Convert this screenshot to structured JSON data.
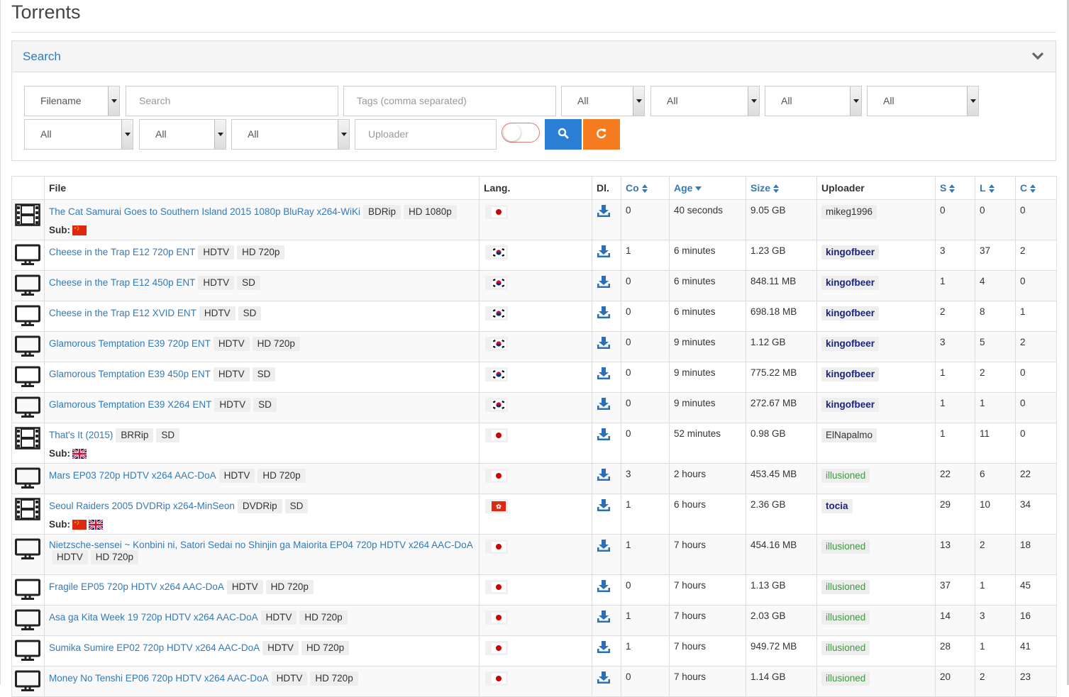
{
  "page": {
    "title": "Torrents"
  },
  "search_panel": {
    "title": "Search",
    "field_type": "Filename",
    "search_placeholder": "Search",
    "tags_placeholder": "Tags (comma separated)",
    "selects_row1": [
      "All",
      "All",
      "All",
      "All"
    ],
    "selects_row2": [
      "All",
      "All",
      "All"
    ],
    "uploader_placeholder": "Uploader"
  },
  "table": {
    "headers": {
      "file": "File",
      "lang": "Lang.",
      "dl": "Dl.",
      "co": "Co",
      "age": "Age",
      "size": "Size",
      "uploader": "Uploader",
      "s": "S",
      "l": "L",
      "c": "C"
    },
    "sub_label": "Sub:",
    "rows": [
      {
        "icon": "film",
        "name": "The Cat Samurai Goes to Southern Island 2015 1080p BluRay x264-WiKi",
        "tags": [
          "BDRip",
          "HD 1080p"
        ],
        "subs": [
          "cn"
        ],
        "lang": "jp",
        "co": "0",
        "age": "40 seconds",
        "size": "9.05 GB",
        "uploader": "mikeg1996",
        "utype": "plain",
        "s": "0",
        "l": "0",
        "c": "0"
      },
      {
        "icon": "tv",
        "name": "Cheese in the Trap E12 720p ENT",
        "tags": [
          "HDTV",
          "HD 720p"
        ],
        "subs": [],
        "lang": "kr",
        "co": "1",
        "age": "6 minutes",
        "size": "1.23 GB",
        "uploader": "kingofbeer",
        "utype": "gold",
        "s": "3",
        "l": "37",
        "c": "2"
      },
      {
        "icon": "tv",
        "name": "Cheese in the Trap E12 450p ENT",
        "tags": [
          "HDTV",
          "SD"
        ],
        "subs": [],
        "lang": "kr",
        "co": "0",
        "age": "6 minutes",
        "size": "848.11 MB",
        "uploader": "kingofbeer",
        "utype": "gold",
        "s": "1",
        "l": "4",
        "c": "0"
      },
      {
        "icon": "tv",
        "name": "Cheese in the Trap E12 XVID ENT",
        "tags": [
          "HDTV",
          "SD"
        ],
        "subs": [],
        "lang": "kr",
        "co": "0",
        "age": "6 minutes",
        "size": "698.18 MB",
        "uploader": "kingofbeer",
        "utype": "gold",
        "s": "2",
        "l": "8",
        "c": "1"
      },
      {
        "icon": "tv",
        "name": "Glamorous Temptation E39 720p ENT",
        "tags": [
          "HDTV",
          "HD 720p"
        ],
        "subs": [],
        "lang": "kr",
        "co": "0",
        "age": "9 minutes",
        "size": "1.12 GB",
        "uploader": "kingofbeer",
        "utype": "gold",
        "s": "3",
        "l": "5",
        "c": "2"
      },
      {
        "icon": "tv",
        "name": "Glamorous Temptation E39 450p ENT",
        "tags": [
          "HDTV",
          "SD"
        ],
        "subs": [],
        "lang": "kr",
        "co": "0",
        "age": "9 minutes",
        "size": "775.22 MB",
        "uploader": "kingofbeer",
        "utype": "gold",
        "s": "1",
        "l": "2",
        "c": "0"
      },
      {
        "icon": "tv",
        "name": "Glamorous Temptation E39 X264 ENT",
        "tags": [
          "HDTV",
          "SD"
        ],
        "subs": [],
        "lang": "kr",
        "co": "0",
        "age": "9 minutes",
        "size": "272.67 MB",
        "uploader": "kingofbeer",
        "utype": "gold",
        "s": "1",
        "l": "1",
        "c": "0"
      },
      {
        "icon": "film",
        "name": "That's It (2015)",
        "tags": [
          "BRRip",
          "SD"
        ],
        "subs": [
          "uk"
        ],
        "lang": "jp",
        "co": "0",
        "age": "52 minutes",
        "size": "0.98 GB",
        "uploader": "ElNapalmo",
        "utype": "plain",
        "s": "1",
        "l": "11",
        "c": "0"
      },
      {
        "icon": "tv",
        "name": "Mars EP03 720p HDTV x264 AAC-DoA",
        "tags": [
          "HDTV",
          "HD 720p"
        ],
        "subs": [],
        "lang": "jp",
        "co": "3",
        "age": "2 hours",
        "size": "453.45 MB",
        "uploader": "illusioned",
        "utype": "green",
        "s": "22",
        "l": "6",
        "c": "22"
      },
      {
        "icon": "film",
        "name": "Seoul Raiders 2005 DVDRip x264-MinSeon",
        "tags": [
          "DVDRip",
          "SD"
        ],
        "subs": [
          "cn",
          "uk"
        ],
        "lang": "hk",
        "co": "1",
        "age": "6 hours",
        "size": "2.36 GB",
        "uploader": "tocia",
        "utype": "blue",
        "s": "29",
        "l": "10",
        "c": "34"
      },
      {
        "icon": "tv",
        "name": "Nietzsche-sensei ~ Konbini ni, Satori Sedai no Shinjin ga Maiorita EP04 720p HDTV x264 AAC-DoA",
        "tags": [
          "HDTV",
          "HD 720p"
        ],
        "subs": [],
        "lang": "jp",
        "co": "1",
        "age": "7 hours",
        "size": "454.16 MB",
        "uploader": "illusioned",
        "utype": "green",
        "s": "13",
        "l": "2",
        "c": "18"
      },
      {
        "icon": "tv",
        "name": "Fragile EP05 720p HDTV x264 AAC-DoA",
        "tags": [
          "HDTV",
          "HD 720p"
        ],
        "subs": [],
        "lang": "jp",
        "co": "0",
        "age": "7 hours",
        "size": "1.13 GB",
        "uploader": "illusioned",
        "utype": "green",
        "s": "37",
        "l": "1",
        "c": "45"
      },
      {
        "icon": "tv",
        "name": "Asa ga Kita Week 19 720p HDTV x264 AAC-DoA",
        "tags": [
          "HDTV",
          "HD 720p"
        ],
        "subs": [],
        "lang": "jp",
        "co": "1",
        "age": "7 hours",
        "size": "2.03 GB",
        "uploader": "illusioned",
        "utype": "green",
        "s": "14",
        "l": "3",
        "c": "16"
      },
      {
        "icon": "tv",
        "name": "Sumika Sumire EP02 720p HDTV x264 AAC-DoA",
        "tags": [
          "HDTV",
          "HD 720p"
        ],
        "subs": [],
        "lang": "jp",
        "co": "1",
        "age": "7 hours",
        "size": "949.72 MB",
        "uploader": "illusioned",
        "utype": "green",
        "s": "28",
        "l": "1",
        "c": "41"
      },
      {
        "icon": "tv",
        "name": "Money No Tenshi EP06 720p HDTV x264 AAC-DoA",
        "tags": [
          "HDTV",
          "HD 720p"
        ],
        "subs": [],
        "lang": "jp",
        "co": "0",
        "age": "7 hours",
        "size": "1.14 GB",
        "uploader": "illusioned",
        "utype": "green",
        "s": "20",
        "l": "2",
        "c": "23"
      }
    ]
  },
  "colors": {
    "link": "#337ab7",
    "search_button": "#2a7fd4",
    "reset_button": "#f47b20",
    "toggle_border": "#e07b6e",
    "uploader_trusted": "#3c9a3c",
    "uploader_vip": "#1a237e"
  }
}
